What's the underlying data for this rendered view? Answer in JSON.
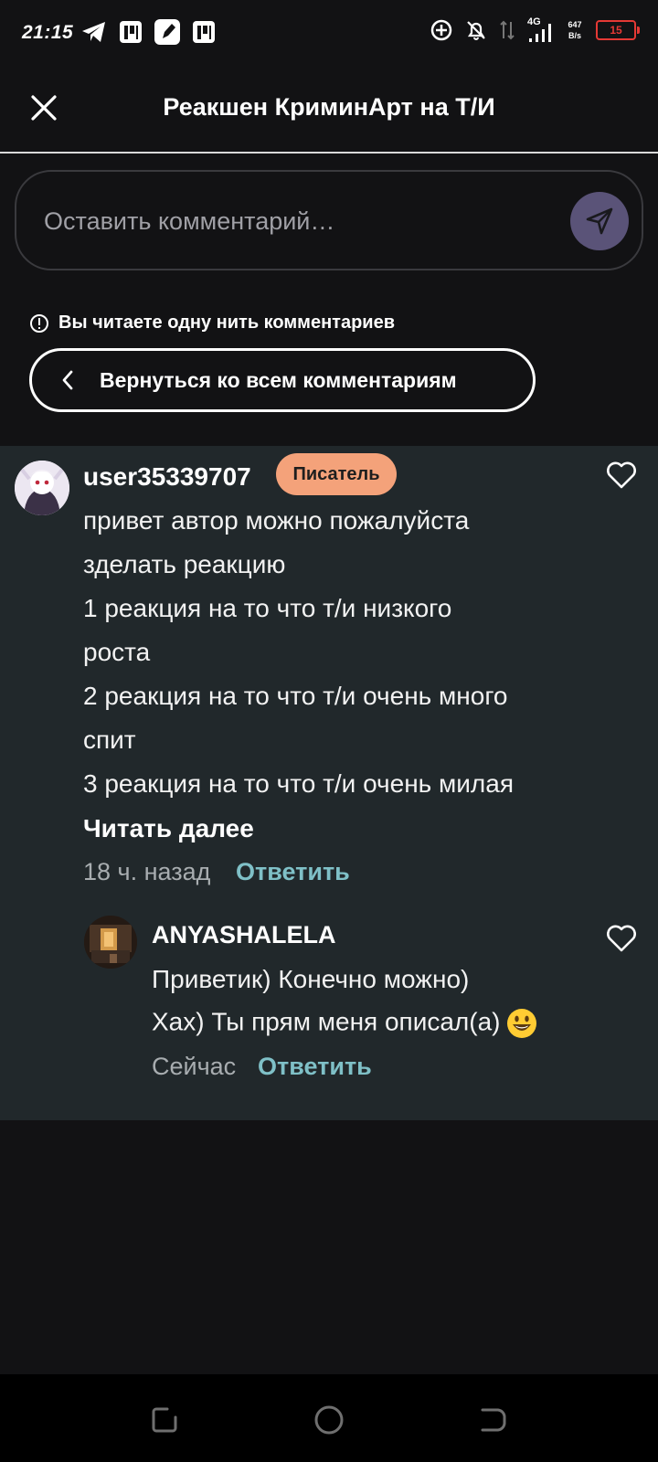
{
  "status_bar": {
    "time": "21:15",
    "left_icons": [
      "telegram-icon",
      "p-app-icon",
      "notes-app-icon",
      "p-app-icon"
    ],
    "right_icons": [
      "data-saver-icon",
      "notifications-off-icon",
      "data-arrows-icon",
      "signal-4g-icon"
    ],
    "network_type": "4G",
    "speed_value": "647",
    "speed_unit": "B/s",
    "battery_level": "15",
    "battery_color": "#e53935"
  },
  "header": {
    "title": "Реакшен КриминАрт на Т/И"
  },
  "comment_input": {
    "placeholder": "Оставить комментарий…",
    "send_button_color": "#5a5378"
  },
  "thread_notice": {
    "text": "Вы читаете одну нить комментариев",
    "back_button_label": "Вернуться ко всем комментариям"
  },
  "comment": {
    "username": "user35339707",
    "badge": "Писатель",
    "badge_color": "#f4a27a",
    "lines": [
      "привет автор можно пожалуйста",
      "зделать реакцию",
      "1 реакция на то что т/и низкого",
      "роста",
      "2 реакция на то что т/и очень много",
      "спит",
      "3 реакция на то что т/и очень милая"
    ],
    "read_more": "Читать далее",
    "time": "18 ч. назад",
    "reply_label": "Ответить"
  },
  "reply_comment": {
    "username": "ANYASHALELA",
    "lines": [
      "Приветик) Конечно можно)",
      "Хах) Ты прям меня описал(а)"
    ],
    "emoji": "😃",
    "time": "Сейчас",
    "reply_label": "Ответить"
  },
  "colors": {
    "background": "#121214",
    "thread_background": "#21282b",
    "reply_accent": "#7fc0c7"
  }
}
